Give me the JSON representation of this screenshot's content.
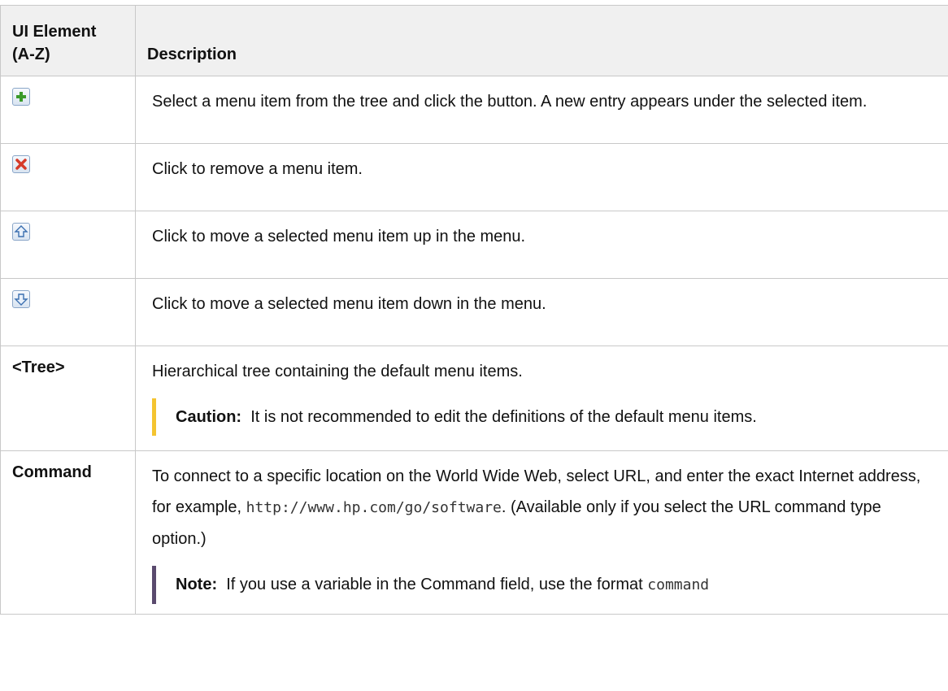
{
  "header": {
    "col1_line1": "UI Element",
    "col1_line2": "(A-Z)",
    "col2": "Description"
  },
  "rows": [
    {
      "icon": "add-icon",
      "description": "Select a menu item from the tree and click the button. A new entry appears under the selected item."
    },
    {
      "icon": "delete-icon",
      "description": "Click to remove a menu item."
    },
    {
      "icon": "move-up-icon",
      "description": "Click to move a selected menu item up in the menu."
    },
    {
      "icon": "move-down-icon",
      "description": "Click to move a selected menu item down in the menu."
    },
    {
      "element": "<Tree>",
      "description": "Hierarchical tree containing the default menu items.",
      "callout_label": "Caution:",
      "callout_text": "It is not recommended to edit the definitions of the default menu items."
    },
    {
      "element": "Command",
      "description_part1": "To connect to a specific location on the World Wide Web, select URL, and enter the exact Internet address, for example, ",
      "description_code": "http://www.hp.com/go/software",
      "description_part2": ". (Available only if you select the URL command type option.)",
      "note_label": "Note:",
      "note_text": "If you use a variable in the Command field, use the format ",
      "note_code": "command"
    }
  ],
  "colors": {
    "header_bg": "#f0f0f0",
    "border": "#c8c8c8",
    "caution_bar": "#f4c430",
    "note_bar": "#5a4a6e"
  }
}
